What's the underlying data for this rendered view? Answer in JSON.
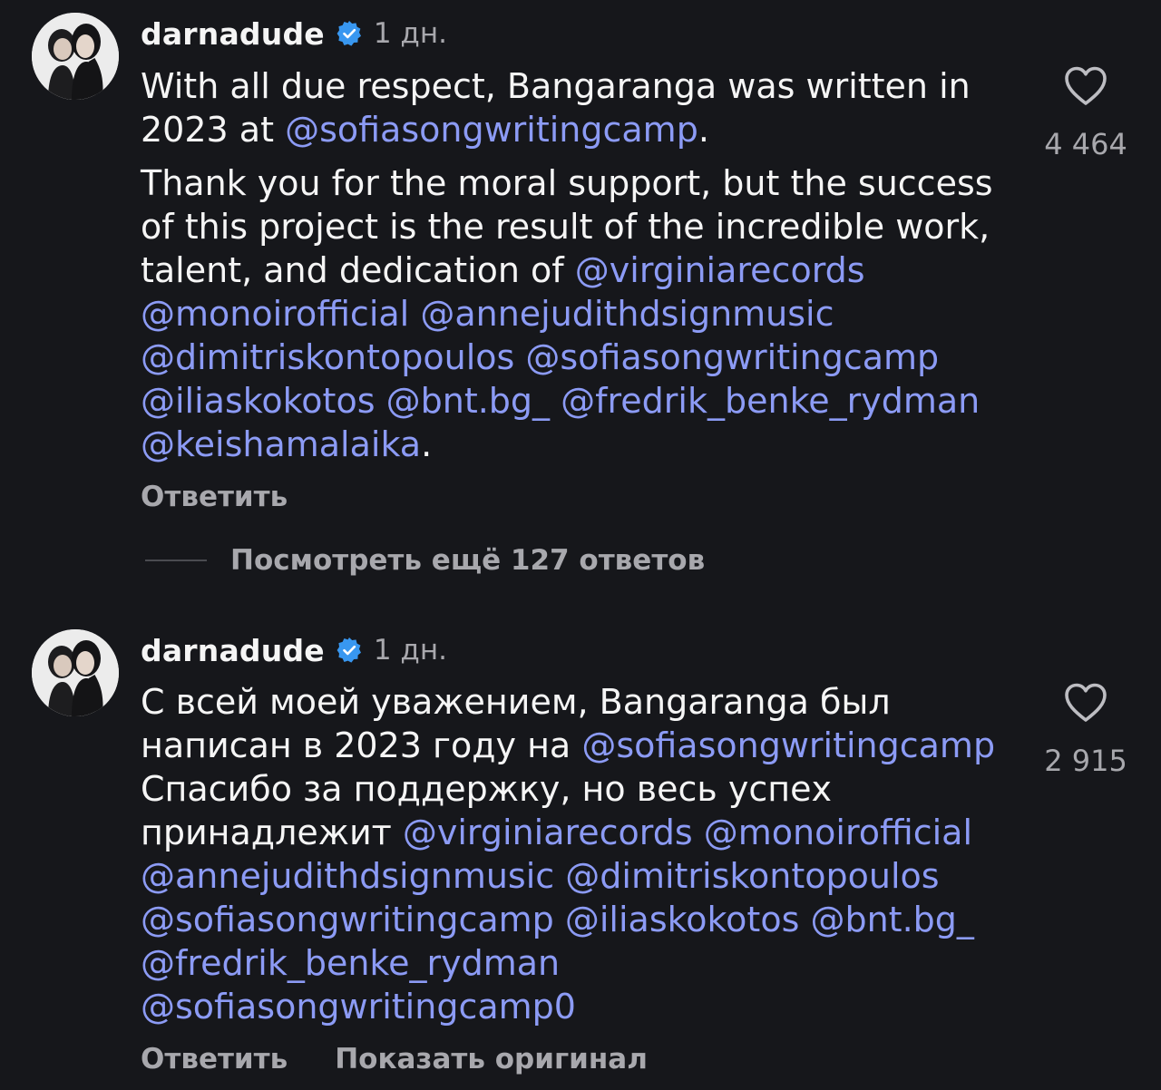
{
  "accent_color": "#8c9bf5",
  "verified_color": "#3897f0",
  "comments": [
    {
      "username": "darnadude",
      "verified_icon": "verified-badge-icon",
      "time": "1 дн.",
      "likes": "4 464",
      "text": {
        "l1": "With all due respect, Bangaranga was written in",
        "l2a": "2023 at ",
        "l2m": "@sofiasongwritingcamp",
        "l2b": ".",
        "l3": "Thank you for the moral support, but the success",
        "l4": "of this project is the result of the incredible work,",
        "l5a": "talent, and dedication of ",
        "l5m": "@virginiarecords",
        "l6m1": "@monoirofficial",
        "l6m2": "@annejudithdsignmusic",
        "l7m1": "@dimitriskontopoulos",
        "l7m2": "@sofiasongwritingcamp",
        "l8m1": "@iliaskokotos",
        "l8m2": "@bnt.bg_",
        "l8m3": "@fredrik_benke_rydman",
        "l9m": "@keishamalaika",
        "l9b": "."
      },
      "reply_label": "Ответить",
      "view_replies_label": "Посмотреть ещё 127 ответов"
    },
    {
      "username": "darnadude",
      "verified_icon": "verified-badge-icon",
      "time": "1 дн.",
      "likes": "2 915",
      "text": {
        "l1": "С всей моей уважением, Bangaranga был",
        "l2a": "написан в 2023 году на ",
        "l2m": "@sofiasongwritingcamp",
        "l3": "Спасибо за поддержку, но весь успех",
        "l4a": "принадлежит ",
        "l4m1": "@virginiarecords",
        "l4m2": "@monoirofficial",
        "l5m1": "@annejudithdsignmusic",
        "l5m2": "@dimitriskontopoulos",
        "l6m1": "@sofiasongwritingcamp",
        "l6m2": "@iliaskokotos",
        "l6m3": "@bnt.bg_",
        "l7m": "@fredrik_benke_rydman",
        "l8m": "@sofiasongwritingcamp0"
      },
      "reply_label": "Ответить",
      "translate_label": "Показать оригинал"
    }
  ]
}
